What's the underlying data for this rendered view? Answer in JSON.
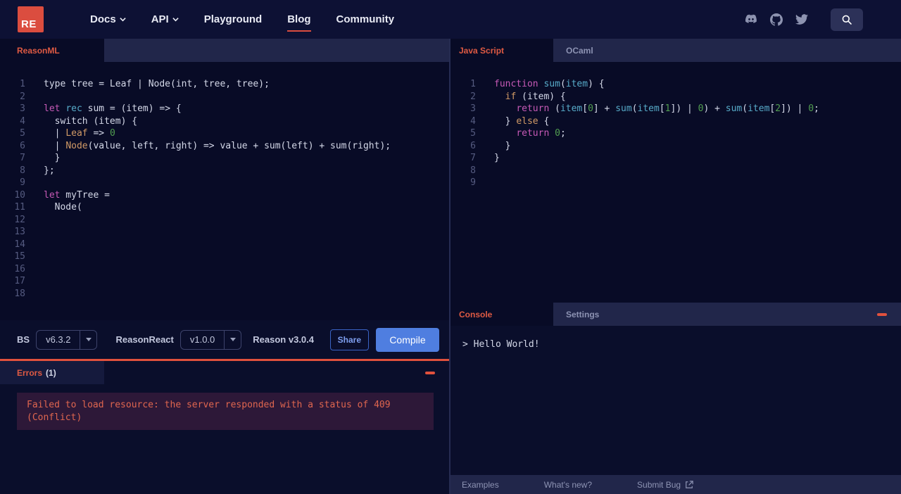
{
  "theme": {
    "accent_red": "#db4d3f",
    "button_blue": "#4f7ee0",
    "tab_active_text": "#df5a43"
  },
  "header": {
    "logo": "RE",
    "nav": [
      {
        "label": "Docs",
        "caret": true
      },
      {
        "label": "API",
        "caret": true
      },
      {
        "label": "Playground",
        "caret": false
      },
      {
        "label": "Blog",
        "caret": false,
        "active": true
      },
      {
        "label": "Community",
        "caret": false
      }
    ],
    "icons": [
      "discord-icon",
      "github-icon",
      "twitter-icon",
      "search-icon"
    ]
  },
  "left": {
    "tab": "ReasonML",
    "editor": {
      "lines": [
        [
          [
            "d",
            "type tree = Leaf | Node(int, tree, tree);"
          ]
        ],
        [],
        [
          [
            "k",
            "let"
          ],
          [
            "d",
            " "
          ],
          [
            "c",
            "rec"
          ],
          [
            "d",
            " sum = (item) => {"
          ]
        ],
        [
          [
            "d",
            "  switch (item) {"
          ]
        ],
        [
          [
            "d",
            "  | "
          ],
          [
            "o",
            "Leaf"
          ],
          [
            "d",
            " => "
          ],
          [
            "g",
            "0"
          ]
        ],
        [
          [
            "d",
            "  | "
          ],
          [
            "o",
            "Node"
          ],
          [
            "d",
            "(value, left, right) => value + sum(left) + sum(right);"
          ]
        ],
        [
          [
            "d",
            "  }"
          ]
        ],
        [
          [
            "d",
            "};"
          ]
        ],
        [],
        [
          [
            "k",
            "let"
          ],
          [
            "d",
            " myTree ="
          ]
        ],
        [
          [
            "d",
            "  Node("
          ]
        ],
        [],
        [],
        [],
        [],
        [],
        [],
        []
      ]
    },
    "toolbar": {
      "bs_label": "BS",
      "bs_version": "v6.3.2",
      "reasonreact_label": "ReasonReact",
      "reasonreact_version": "v1.0.0",
      "reason_version": "Reason v3.0.4",
      "share_label": "Share",
      "compile_label": "Compile"
    },
    "errors": {
      "title": "Errors",
      "count": "(1)",
      "message": "Failed to load resource: the server responded with a status of 409 (Conflict)"
    }
  },
  "right": {
    "tabs": [
      {
        "label": "Java Script",
        "active": true
      },
      {
        "label": "OCaml",
        "active": false
      }
    ],
    "editor": {
      "lines": [
        [
          [
            "k",
            "function"
          ],
          [
            "d",
            " "
          ],
          [
            "c",
            "sum"
          ],
          [
            "d",
            "("
          ],
          [
            "c",
            "item"
          ],
          [
            "d",
            ") {"
          ]
        ],
        [
          [
            "d",
            "  "
          ],
          [
            "o",
            "if"
          ],
          [
            "d",
            " (item) {"
          ]
        ],
        [
          [
            "d",
            "    "
          ],
          [
            "k",
            "return"
          ],
          [
            "d",
            " ("
          ],
          [
            "c",
            "item"
          ],
          [
            "d",
            "["
          ],
          [
            "g",
            "0"
          ],
          [
            "d",
            "] + "
          ],
          [
            "c",
            "sum"
          ],
          [
            "d",
            "("
          ],
          [
            "c",
            "item"
          ],
          [
            "d",
            "["
          ],
          [
            "g",
            "1"
          ],
          [
            "d",
            "]) | "
          ],
          [
            "g",
            "0"
          ],
          [
            "d",
            ") + "
          ],
          [
            "c",
            "sum"
          ],
          [
            "d",
            "("
          ],
          [
            "c",
            "item"
          ],
          [
            "d",
            "["
          ],
          [
            "g",
            "2"
          ],
          [
            "d",
            "]) | "
          ],
          [
            "g",
            "0"
          ],
          [
            "d",
            ";"
          ]
        ],
        [
          [
            "d",
            "  } "
          ],
          [
            "o",
            "else"
          ],
          [
            "d",
            " {"
          ]
        ],
        [
          [
            "d",
            "    "
          ],
          [
            "k",
            "return"
          ],
          [
            "d",
            " "
          ],
          [
            "g",
            "0"
          ],
          [
            "d",
            ";"
          ]
        ],
        [
          [
            "d",
            "  }"
          ]
        ],
        [
          [
            "d",
            "}"
          ]
        ],
        [],
        []
      ]
    },
    "console": {
      "tabs": [
        {
          "label": "Console",
          "active": true
        },
        {
          "label": "Settings",
          "active": false
        }
      ],
      "output": "> Hello World!"
    },
    "footer": {
      "examples": "Examples",
      "whats_new": "What's new?",
      "submit_bug": "Submit Bug"
    }
  }
}
